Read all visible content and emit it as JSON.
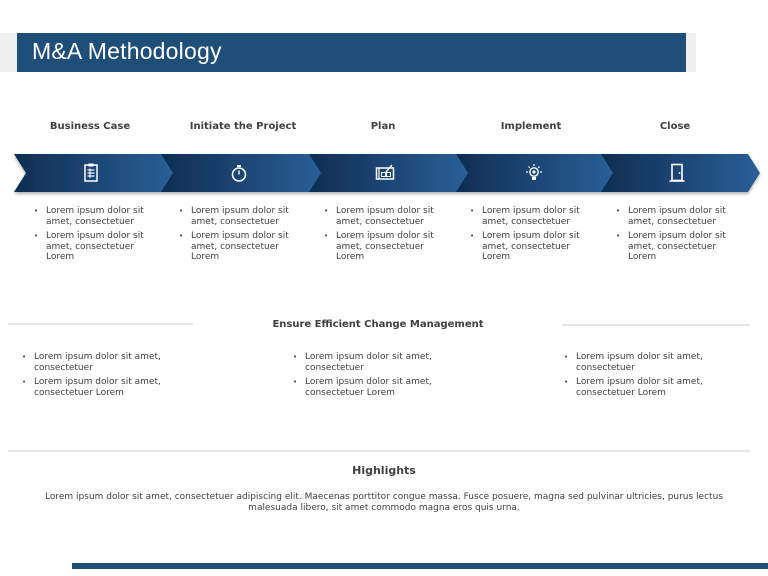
{
  "header": {
    "title": "M&A Methodology"
  },
  "colors": {
    "brand": "#1f4e79",
    "dark": "#0f2d52",
    "light": "#2a5f97",
    "text": "#404040"
  },
  "phases": [
    {
      "title": "Business Case",
      "icon": "clipboard-icon",
      "bullets": [
        "Lorem ipsum dolor sit amet, consectetuer",
        "Lorem ipsum dolor sit amet, consectetuer Lorem"
      ]
    },
    {
      "title": "Initiate the Project",
      "icon": "stopwatch-icon",
      "bullets": [
        "Lorem ipsum dolor sit amet, consectetuer",
        "Lorem ipsum dolor sit amet, consectetuer Lorem"
      ]
    },
    {
      "title": "Plan",
      "icon": "blueprint-icon",
      "bullets": [
        "Lorem ipsum dolor sit amet, consectetuer",
        "Lorem ipsum dolor sit amet, consectetuer Lorem"
      ]
    },
    {
      "title": "Implement",
      "icon": "lightbulb-icon",
      "bullets": [
        "Lorem ipsum dolor sit amet, consectetuer",
        "Lorem ipsum dolor sit amet, consectetuer Lorem"
      ]
    },
    {
      "title": "Close",
      "icon": "door-icon",
      "bullets": [
        "Lorem ipsum dolor sit amet, consectetuer",
        "Lorem ipsum dolor sit amet, consectetuer Lorem"
      ]
    }
  ],
  "change_management": {
    "title": "Ensure Efficient Change Management",
    "columns": [
      {
        "bullets": [
          "Lorem ipsum dolor sit amet, consectetuer",
          "Lorem ipsum dolor sit amet, consectetuer Lorem"
        ]
      },
      {
        "bullets": [
          "Lorem ipsum dolor sit amet, consectetuer",
          "Lorem ipsum dolor sit amet, consectetuer Lorem"
        ]
      },
      {
        "bullets": [
          "Lorem ipsum dolor sit amet, consectetuer",
          "Lorem ipsum dolor sit amet, consectetuer Lorem"
        ]
      }
    ]
  },
  "highlights": {
    "title": "Highlights",
    "text": "Lorem ipsum dolor sit amet, consectetuer adipiscing elit. Maecenas porttitor congue massa. Fusce posuere, magna sed pulvinar ultricies, purus lectus malesuada libero, sit amet commodo magna eros quis urna."
  }
}
